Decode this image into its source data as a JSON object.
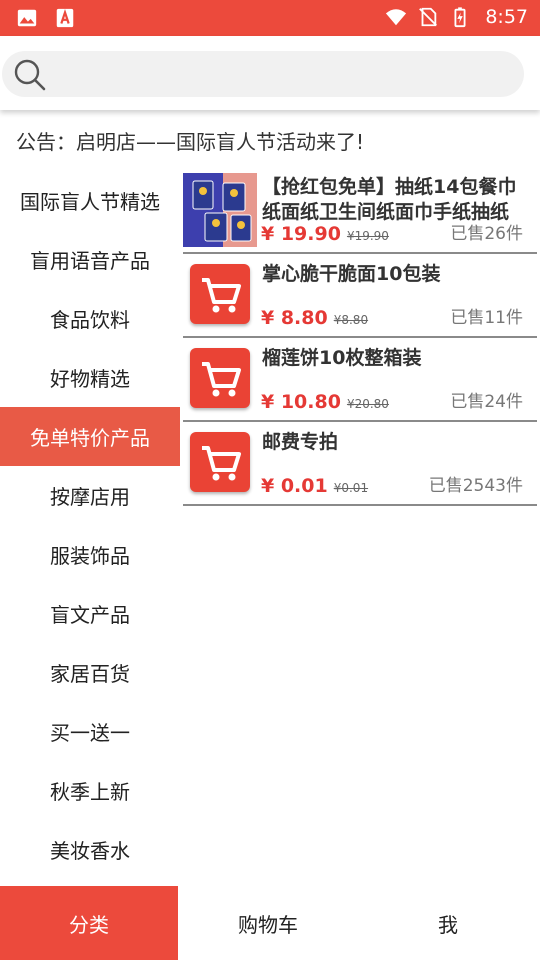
{
  "status_bar": {
    "time": "8:57",
    "left_icons": [
      "image-icon",
      "pdf-icon"
    ],
    "right_icons": [
      "wifi-icon",
      "no-sim-icon",
      "battery-charging-icon"
    ],
    "color": "#ec4a3c"
  },
  "search": {
    "placeholder": "",
    "icon": "search-icon"
  },
  "notice": {
    "text": "公告：启明店——国际盲人节活动来了!"
  },
  "sidebar": {
    "active_index": 4,
    "items": [
      {
        "label": "国际盲人节精选"
      },
      {
        "label": "盲用语音产品"
      },
      {
        "label": "食品饮料"
      },
      {
        "label": "好物精选"
      },
      {
        "label": "免单特价产品"
      },
      {
        "label": "按摩店用"
      },
      {
        "label": "服装饰品"
      },
      {
        "label": "盲文产品"
      },
      {
        "label": "家居百货"
      },
      {
        "label": "买一送一"
      },
      {
        "label": "秋季上新"
      },
      {
        "label": "美妆香水"
      }
    ]
  },
  "products": [
    {
      "title": "【抢红包免单】抽纸14包餐巾纸面纸卫生间纸面巾手纸抽纸",
      "price": "¥ 19.90",
      "old_price": "¥19.90",
      "sold": "已售26件",
      "thumb": "tissue-photo"
    },
    {
      "title": "掌心脆干脆面10包装",
      "price": "¥ 8.80",
      "old_price": "¥8.80",
      "sold": "已售11件",
      "thumb": "cart-icon"
    },
    {
      "title": "榴莲饼10枚整箱装",
      "price": "¥ 10.80",
      "old_price": "¥20.80",
      "sold": "已售24件",
      "thumb": "cart-icon"
    },
    {
      "title": "邮费专拍",
      "price": "¥ 0.01",
      "old_price": "¥0.01",
      "sold": "已售2543件",
      "thumb": "cart-icon"
    }
  ],
  "bottom_nav": {
    "active_index": 0,
    "tabs": [
      {
        "label": "分类"
      },
      {
        "label": "购物车"
      },
      {
        "label": "我"
      }
    ]
  },
  "colors": {
    "accent": "#ec4a3c",
    "sidebar_active": "#e85a46",
    "price": "#e53935"
  }
}
